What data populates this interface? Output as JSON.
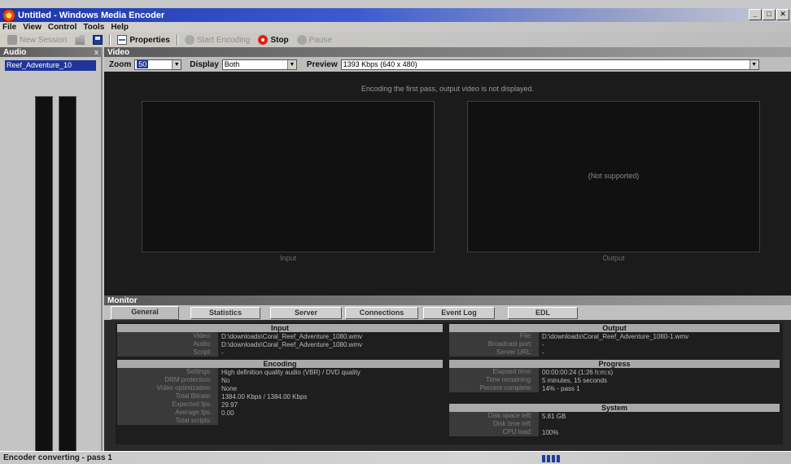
{
  "window": {
    "title": "Untitled - Windows Media Encoder",
    "controls": [
      "_",
      "□",
      "✕"
    ]
  },
  "menu": [
    "File",
    "View",
    "Control",
    "Tools",
    "Help"
  ],
  "toolbar": {
    "new_session": "New Session",
    "properties": "Properties",
    "start_encoding": "Start Encoding",
    "stop": "Stop",
    "pause": "Pause"
  },
  "audio": {
    "title": "Audio",
    "close": "x",
    "source": "Reef_Adventure_10"
  },
  "video": {
    "title": "Video",
    "zoom_label": "Zoom",
    "zoom_value": "50",
    "display_label": "Display",
    "display_value": "Both",
    "preview_label": "Preview",
    "preview_value": "1393 Kbps (640 x 480)",
    "message": "Encoding the first pass, output video is not displayed.",
    "not_supported": "(Not supported)",
    "input_caption": "Input",
    "output_caption": "Output"
  },
  "monitor": {
    "title": "Monitor",
    "tabs": [
      "General",
      "Statistics",
      "Server",
      "Connections",
      "Event Log",
      "EDL"
    ],
    "input": {
      "title": "Input",
      "rows": [
        {
          "label": "Video:",
          "value": "D:\\downloads\\Coral_Reef_Adventure_1080.wmv"
        },
        {
          "label": "Audio:",
          "value": "D:\\downloads\\Coral_Reef_Adventure_1080.wmv"
        },
        {
          "label": "Script:",
          "value": "-"
        }
      ]
    },
    "encoding": {
      "title": "Encoding",
      "rows": [
        {
          "label": "Settings:",
          "value": "High definition quality audio (VBR) / DVD quality"
        },
        {
          "label": "DRM protection:",
          "value": "No"
        },
        {
          "label": "Video optimization:",
          "value": "None"
        },
        {
          "label": "Total Bitrate:",
          "value": "1384.00 Kbps / 1384.00 Kbps"
        },
        {
          "label": "Expected fps:",
          "value": "29.97"
        },
        {
          "label": "Average fps:",
          "value": "0.00"
        },
        {
          "label": "Total scripts:",
          "value": ""
        }
      ]
    },
    "output": {
      "title": "Output",
      "rows": [
        {
          "label": "File:",
          "value": "D:\\downloads\\Coral_Reef_Adventure_1080-1.wmv"
        },
        {
          "label": "Broadcast port:",
          "value": "-"
        },
        {
          "label": "Server URL:",
          "value": "-"
        }
      ]
    },
    "progress": {
      "title": "Progress",
      "rows": [
        {
          "label": "Elapsed time:",
          "value": "00:00:00:24 (1:26 h:m:s)"
        },
        {
          "label": "Time remaining:",
          "value": "5 minutes, 15 seconds"
        },
        {
          "label": "Percent complete:",
          "value": "14% - pass 1"
        }
      ]
    },
    "system": {
      "title": "System",
      "rows": [
        {
          "label": "Disk space left:",
          "value": "5.81 GB"
        },
        {
          "label": "Disk time left:",
          "value": ""
        },
        {
          "label": "CPU load:",
          "value": "100%"
        }
      ]
    }
  },
  "status": {
    "text": "Encoder converting - pass 1"
  },
  "colors": {
    "title_bar": "#1d36a8",
    "stop_red": "#e02014",
    "meter_green": "#35c028",
    "selection_blue": "#24389c"
  }
}
